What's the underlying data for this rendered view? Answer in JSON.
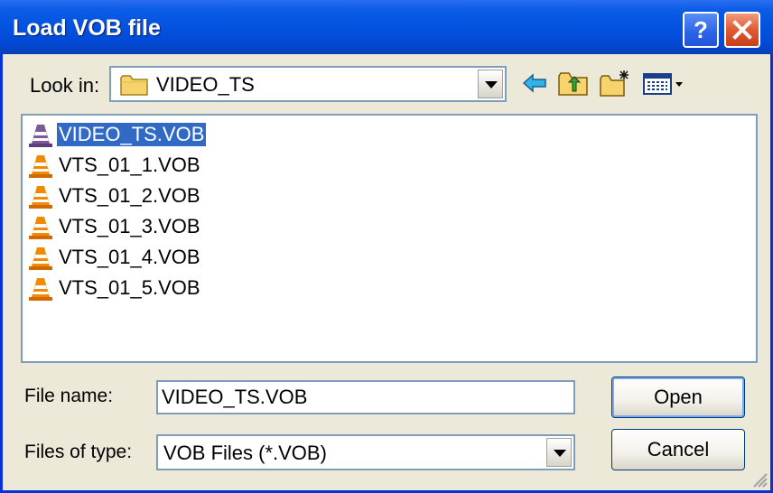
{
  "window": {
    "title": "Load VOB file",
    "help_button": "?",
    "close_button": "✕"
  },
  "lookin": {
    "label": "Look in:",
    "value": "VIDEO_TS"
  },
  "toolbar": {
    "icons": [
      "back-icon",
      "up-folder-icon",
      "new-folder-icon",
      "view-menu-icon"
    ]
  },
  "files": [
    {
      "name": "VIDEO_TS.VOB",
      "selected": true
    },
    {
      "name": "VTS_01_1.VOB",
      "selected": false
    },
    {
      "name": "VTS_01_2.VOB",
      "selected": false
    },
    {
      "name": "VTS_01_3.VOB",
      "selected": false
    },
    {
      "name": "VTS_01_4.VOB",
      "selected": false
    },
    {
      "name": "VTS_01_5.VOB",
      "selected": false
    }
  ],
  "filename": {
    "label": "File name:",
    "value": "VIDEO_TS.VOB"
  },
  "filetype": {
    "label": "Files of type:",
    "value": "VOB Files (*.VOB)"
  },
  "buttons": {
    "open": "Open",
    "cancel": "Cancel"
  },
  "colors": {
    "title_bar": "#0452DF",
    "dialog_bg": "#ECE9D8",
    "selection": "#316AC5",
    "cone": "#F08A00"
  }
}
